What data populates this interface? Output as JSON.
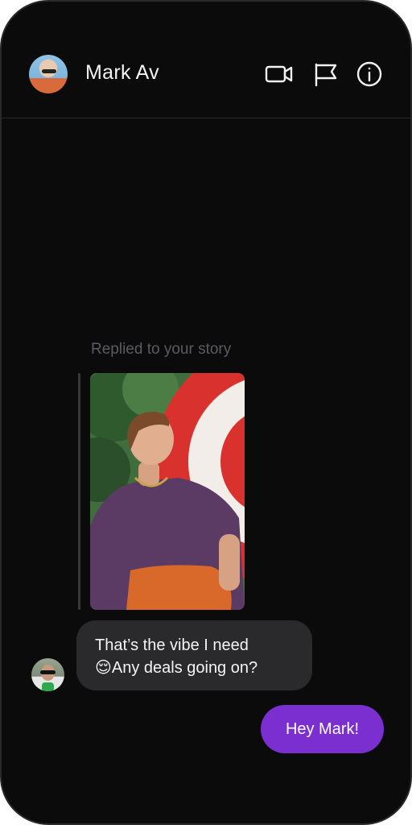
{
  "header": {
    "contact_name": "Mark Av",
    "icons": [
      "video-call-icon",
      "flag-icon",
      "info-icon"
    ]
  },
  "conversation": {
    "reply_context": "Replied to your story",
    "incoming_message": {
      "line1": "That’s the vibe I need",
      "emoji": "😌",
      "line2": "Any deals going on?"
    },
    "outgoing_message": "Hey Mark!"
  },
  "colors": {
    "background": "#0b0b0c",
    "incoming_bubble": "#2a2a2c",
    "outgoing_bubble": "#7b2fd1",
    "header_divider": "#2b2b2d"
  }
}
